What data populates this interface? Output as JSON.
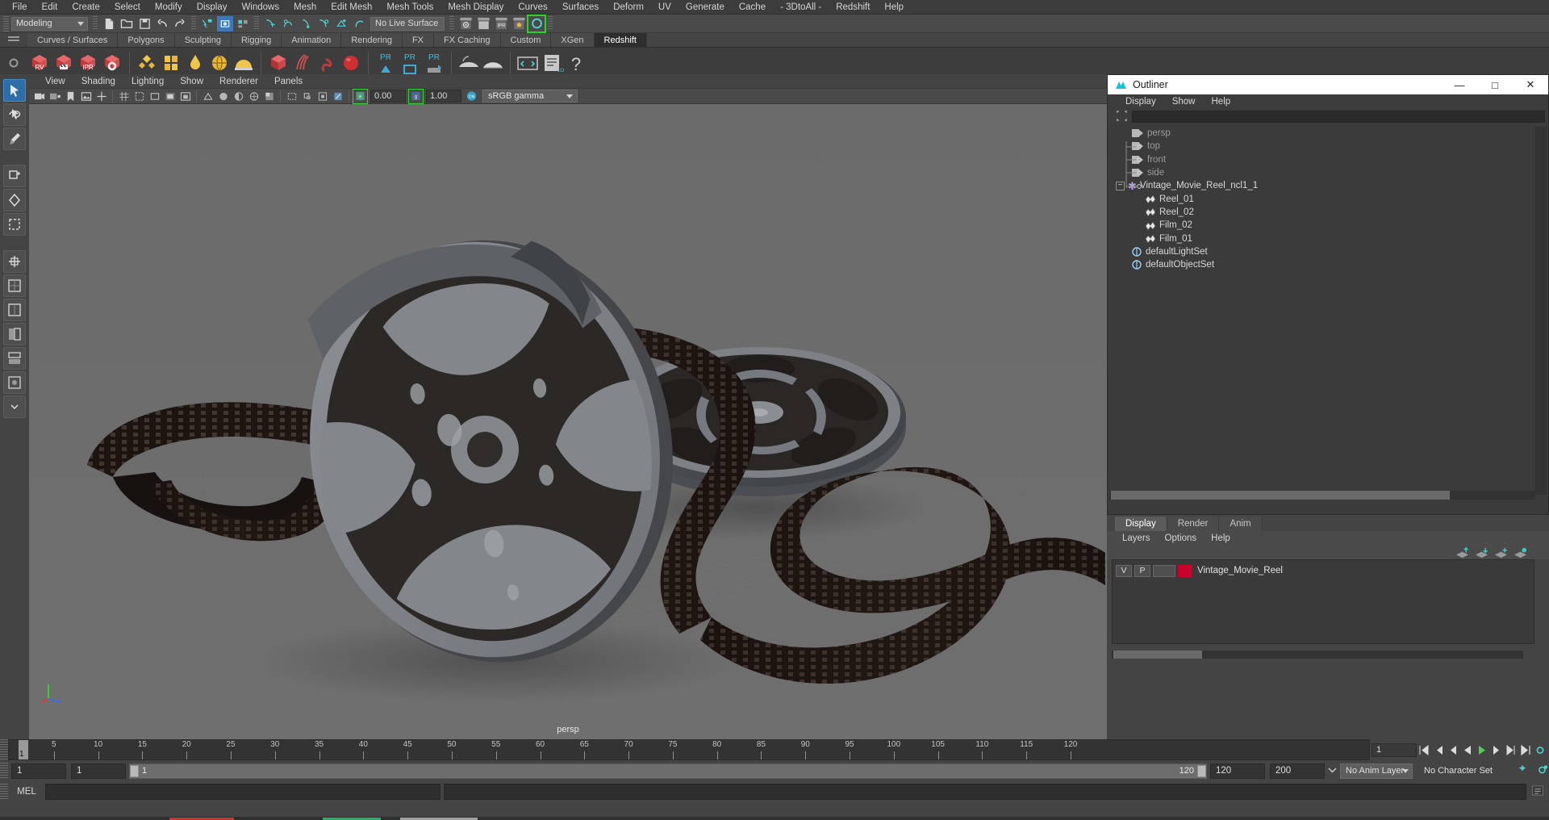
{
  "menubar": {
    "items": [
      "File",
      "Edit",
      "Create",
      "Select",
      "Modify",
      "Display",
      "Windows",
      "Mesh",
      "Edit Mesh",
      "Mesh Tools",
      "Mesh Display",
      "Curves",
      "Surfaces",
      "Deform",
      "UV",
      "Generate",
      "Cache",
      "- 3DtoAll -",
      "Redshift",
      "Help"
    ]
  },
  "statusline": {
    "menuset": "Modeling",
    "live_surface": "No Live Surface"
  },
  "shelf": {
    "tabs": [
      "Curves / Surfaces",
      "Polygons",
      "Sculpting",
      "Rigging",
      "Animation",
      "Rendering",
      "FX",
      "FX Caching",
      "Custom",
      "XGen",
      "Redshift"
    ],
    "active_tab": "Redshift",
    "buttons": [
      "RV",
      "clapperboard",
      "IPR",
      "gear",
      "diamond",
      "grid",
      "drop",
      "sphere-sky",
      "dome",
      "cube-red",
      "hair",
      "snake",
      "sphere-light",
      "PR",
      "PR",
      "PR",
      "volume",
      "volume2",
      "code",
      "log",
      "help"
    ]
  },
  "viewport": {
    "menus": [
      "View",
      "Shading",
      "Lighting",
      "Show",
      "Renderer",
      "Panels"
    ],
    "exposure": "0.00",
    "gamma_value": "1.00",
    "color_management": "sRGB gamma",
    "camera_label": "persp"
  },
  "outliner": {
    "title": "Outliner",
    "window_buttons": {
      "minimize": "—",
      "maximize": "□",
      "close": "✕"
    },
    "menus": [
      "Display",
      "Show",
      "Help"
    ],
    "search_value": "",
    "search_placeholder": "",
    "rows": [
      {
        "label": "persp",
        "icon": "camera-icon",
        "indent": 28,
        "dim": true,
        "expander": null
      },
      {
        "label": "top",
        "icon": "camera-icon",
        "indent": 28,
        "dim": true,
        "expander": null
      },
      {
        "label": "front",
        "icon": "camera-icon",
        "indent": 28,
        "dim": true,
        "expander": null
      },
      {
        "label": "side",
        "icon": "camera-icon",
        "indent": 28,
        "dim": true,
        "expander": null
      },
      {
        "label": "Vintage_Movie_Reel_ncl1_1",
        "icon": "star-icon",
        "indent": 8,
        "dim": false,
        "expander": "-"
      },
      {
        "label": "Reel_01",
        "icon": "mesh-icon",
        "indent": 44,
        "dim": false,
        "expander": null
      },
      {
        "label": "Reel_02",
        "icon": "mesh-icon",
        "indent": 44,
        "dim": false,
        "expander": null
      },
      {
        "label": "Film_02",
        "icon": "mesh-icon",
        "indent": 44,
        "dim": false,
        "expander": null
      },
      {
        "label": "Film_01",
        "icon": "mesh-icon",
        "indent": 44,
        "dim": false,
        "expander": null
      },
      {
        "label": "defaultLightSet",
        "icon": "set-icon",
        "indent": 28,
        "dim": false,
        "expander": null
      },
      {
        "label": "defaultObjectSet",
        "icon": "set-icon",
        "indent": 28,
        "dim": false,
        "expander": null
      }
    ]
  },
  "layer_editor": {
    "tabs": [
      "Display",
      "Render",
      "Anim"
    ],
    "active_tab": "Display",
    "menus": [
      "Layers",
      "Options",
      "Help"
    ],
    "toolbar_icons": [
      "move-layer-up-icon",
      "move-layer-down-icon",
      "new-layer-icon",
      "new-layer-from-selected-icon"
    ],
    "layers": [
      {
        "visibility": "V",
        "playback": "P",
        "state": "",
        "color": "#c9002b",
        "name": "Vintage_Movie_Reel"
      }
    ]
  },
  "timeline": {
    "ticks": [
      1,
      5,
      10,
      15,
      20,
      25,
      30,
      35,
      40,
      45,
      50,
      55,
      60,
      65,
      70,
      75,
      80,
      85,
      90,
      95,
      100,
      105,
      110,
      115,
      120
    ],
    "current_frame_marker": "1",
    "current_frame_field": "1",
    "playback_buttons": [
      "go-to-start-icon",
      "step-back-key-icon",
      "step-back-frame-icon",
      "play-backwards-icon",
      "play-forwards-icon",
      "step-forward-frame-icon",
      "step-forward-key-icon",
      "go-to-end-icon"
    ]
  },
  "range": {
    "anim_start": "1",
    "range_start": "1",
    "slider_min_label": "1",
    "slider_max_label": "120",
    "range_end": "120",
    "anim_end": "200",
    "anim_layer": "No Anim Layer",
    "character_set": "No Character Set"
  },
  "command_line": {
    "language_label": "MEL",
    "input_value": "",
    "output_value": ""
  },
  "colors": {
    "accent_blue": "#3f78b4",
    "accent_green": "#26d626",
    "shelf_red": "#d93a3a",
    "shelf_yellow": "#e8b53a",
    "layer_red": "#c9002b",
    "panel_bg": "#444444",
    "dark_bg": "#2e2e2e"
  }
}
